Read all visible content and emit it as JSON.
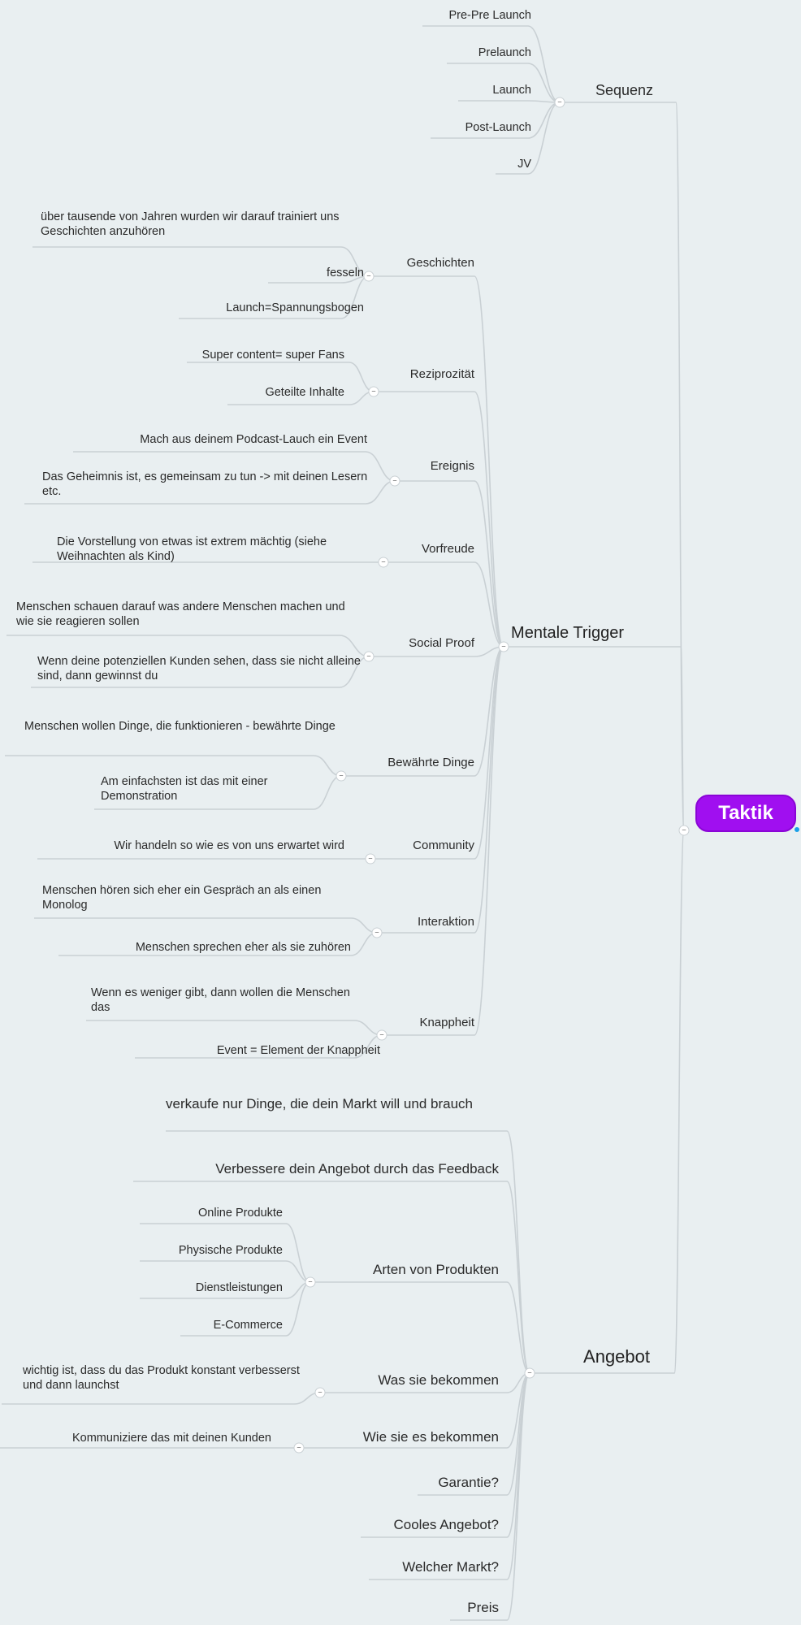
{
  "root": {
    "label": "Taktik"
  },
  "branches": {
    "sequenz": {
      "label": "Sequenz",
      "items": [
        "Pre-Pre Launch",
        "Prelaunch",
        "Launch",
        "Post-Launch",
        "JV"
      ]
    },
    "mentale": {
      "label": "Mentale Trigger",
      "geschichten": {
        "label": "Geschichten",
        "items": [
          "über tausende von Jahren wurden wir darauf trainiert uns Geschichten anzuhören",
          "fesseln",
          "Launch=Spannungsbogen"
        ]
      },
      "reziprozitaet": {
        "label": "Reziprozität",
        "items": [
          "Super content= super Fans",
          "Geteilte Inhalte"
        ]
      },
      "ereignis": {
        "label": "Ereignis",
        "items": [
          "Mach aus deinem Podcast-Lauch ein Event",
          "Das Geheimnis ist, es gemeinsam zu tun -> mit deinen Lesern etc."
        ]
      },
      "vorfreude": {
        "label": "Vorfreude",
        "items": [
          "Die Vorstellung von etwas ist extrem mächtig (siehe Weihnachten als Kind)"
        ]
      },
      "socialproof": {
        "label": "Social Proof",
        "items": [
          "Menschen schauen darauf was andere Menschen machen und wie sie reagieren sollen",
          "Wenn deine potenziellen Kunden sehen, dass sie nicht alleine sind, dann gewinnst du"
        ]
      },
      "bewaehrte": {
        "label": "Bewährte Dinge",
        "items": [
          "Menschen wollen Dinge, die funktionieren - bewährte Dinge",
          "Am einfachsten ist das mit einer Demonstration"
        ]
      },
      "community": {
        "label": "Community",
        "items": [
          "Wir handeln so wie es von uns erwartet wird"
        ]
      },
      "interaktion": {
        "label": "Interaktion",
        "items": [
          "Menschen hören sich eher ein Gespräch an als einen Monolog",
          "Menschen sprechen eher als sie zuhören"
        ]
      },
      "knappheit": {
        "label": "Knappheit",
        "items": [
          "Wenn es weniger gibt, dann wollen die Menschen das",
          "Event = Element der Knappheit"
        ]
      }
    },
    "angebot": {
      "label": "Angebot",
      "verkaufe": "verkaufe nur Dinge, die dein Markt will und brauch",
      "verbessere": "Verbessere dein Angebot durch das Feedback",
      "arten": {
        "label": "Arten von Produkten",
        "items": [
          "Online Produkte",
          "Physische Produkte",
          "Dienstleistungen",
          "E-Commerce"
        ]
      },
      "was": {
        "label": "Was sie bekommen",
        "items": [
          "wichtig ist, dass du das Produkt konstant verbesserst und dann launchst"
        ]
      },
      "wie": {
        "label": "Wie sie es bekommen",
        "items": [
          "Kommuniziere das mit deinen Kunden"
        ]
      },
      "garantie": "Garantie?",
      "cooles": "Cooles Angebot?",
      "markt": "Welcher Markt?",
      "preis": "Preis"
    }
  },
  "colors": {
    "root_fill": "#a00ff0",
    "line": "#c9d0d4",
    "background": "#e9eff1"
  }
}
